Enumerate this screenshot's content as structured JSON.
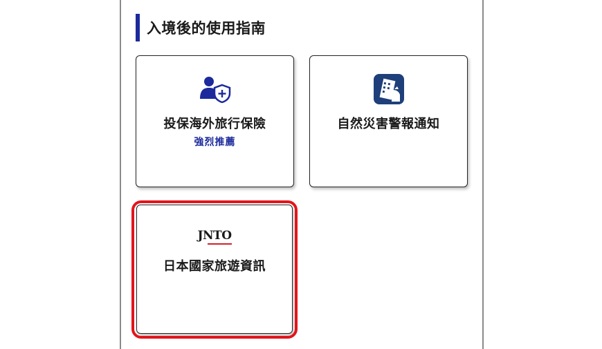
{
  "section": {
    "title": "入境後的使用指南"
  },
  "cards": [
    {
      "label": "投保海外旅行保險",
      "sub": "強烈推薦",
      "icon": "person-shield-icon"
    },
    {
      "label": "自然災害警報通知",
      "icon": "disaster-alert-icon"
    },
    {
      "label": "日本國家旅遊資訊",
      "logo_text": "JNTO",
      "icon": "jnto-logo"
    }
  ],
  "colors": {
    "accent": "#1c2a9c",
    "highlight": "#e3141b",
    "jnto_red": "#d31f2b"
  }
}
